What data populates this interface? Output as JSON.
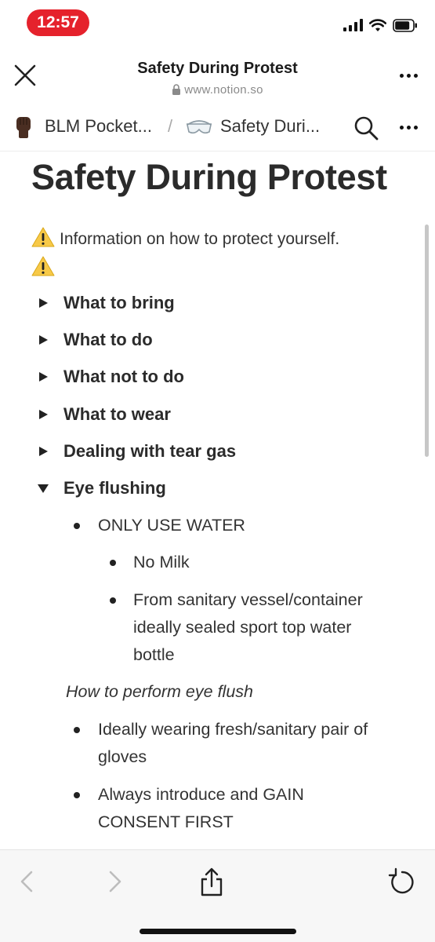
{
  "status_bar": {
    "time": "12:57"
  },
  "browser": {
    "title": "Safety During Protest",
    "url": "www.notion.so"
  },
  "notion_bar": {
    "crumb_parent": "BLM Pocket...",
    "crumb_separator": "/",
    "crumb_current": "Safety Duri..."
  },
  "page": {
    "title": "Safety During Protest",
    "callout": "Information on how to protect yourself.",
    "toggles": [
      {
        "label": "What to bring",
        "expanded": false
      },
      {
        "label": "What to do",
        "expanded": false
      },
      {
        "label": "What not to do",
        "expanded": false
      },
      {
        "label": "What to wear",
        "expanded": false
      },
      {
        "label": "Dealing with tear gas",
        "expanded": false
      },
      {
        "label": "Eye flushing",
        "expanded": true
      }
    ],
    "eye_flushing": {
      "item1": "ONLY USE WATER",
      "sub1": "No Milk",
      "sub2_line1": "From sanitary vessel/container",
      "sub2_line2": "ideally sealed sport top water",
      "sub2_line3": "bottle",
      "italic_heading": "How to perform eye flush",
      "item2_line1": "Ideally wearing fresh/sanitary pair of",
      "item2_line2": "gloves",
      "item3_line1": "Always introduce and GAIN",
      "item3_line2": "CONSENT FIRST"
    }
  },
  "icons": {
    "close": "close-icon",
    "lock": "lock-icon",
    "raised_fist": "raised-fist-icon",
    "goggles": "goggles-icon",
    "warning": "warning-icon",
    "search": "search-icon",
    "more": "more-icon",
    "back": "chevron-left-icon",
    "forward": "chevron-right-icon",
    "share": "share-icon",
    "reload": "reload-icon"
  },
  "colors": {
    "time_pill": "#e5222c",
    "warning": "#f7c948",
    "text": "#2b2b2b"
  }
}
